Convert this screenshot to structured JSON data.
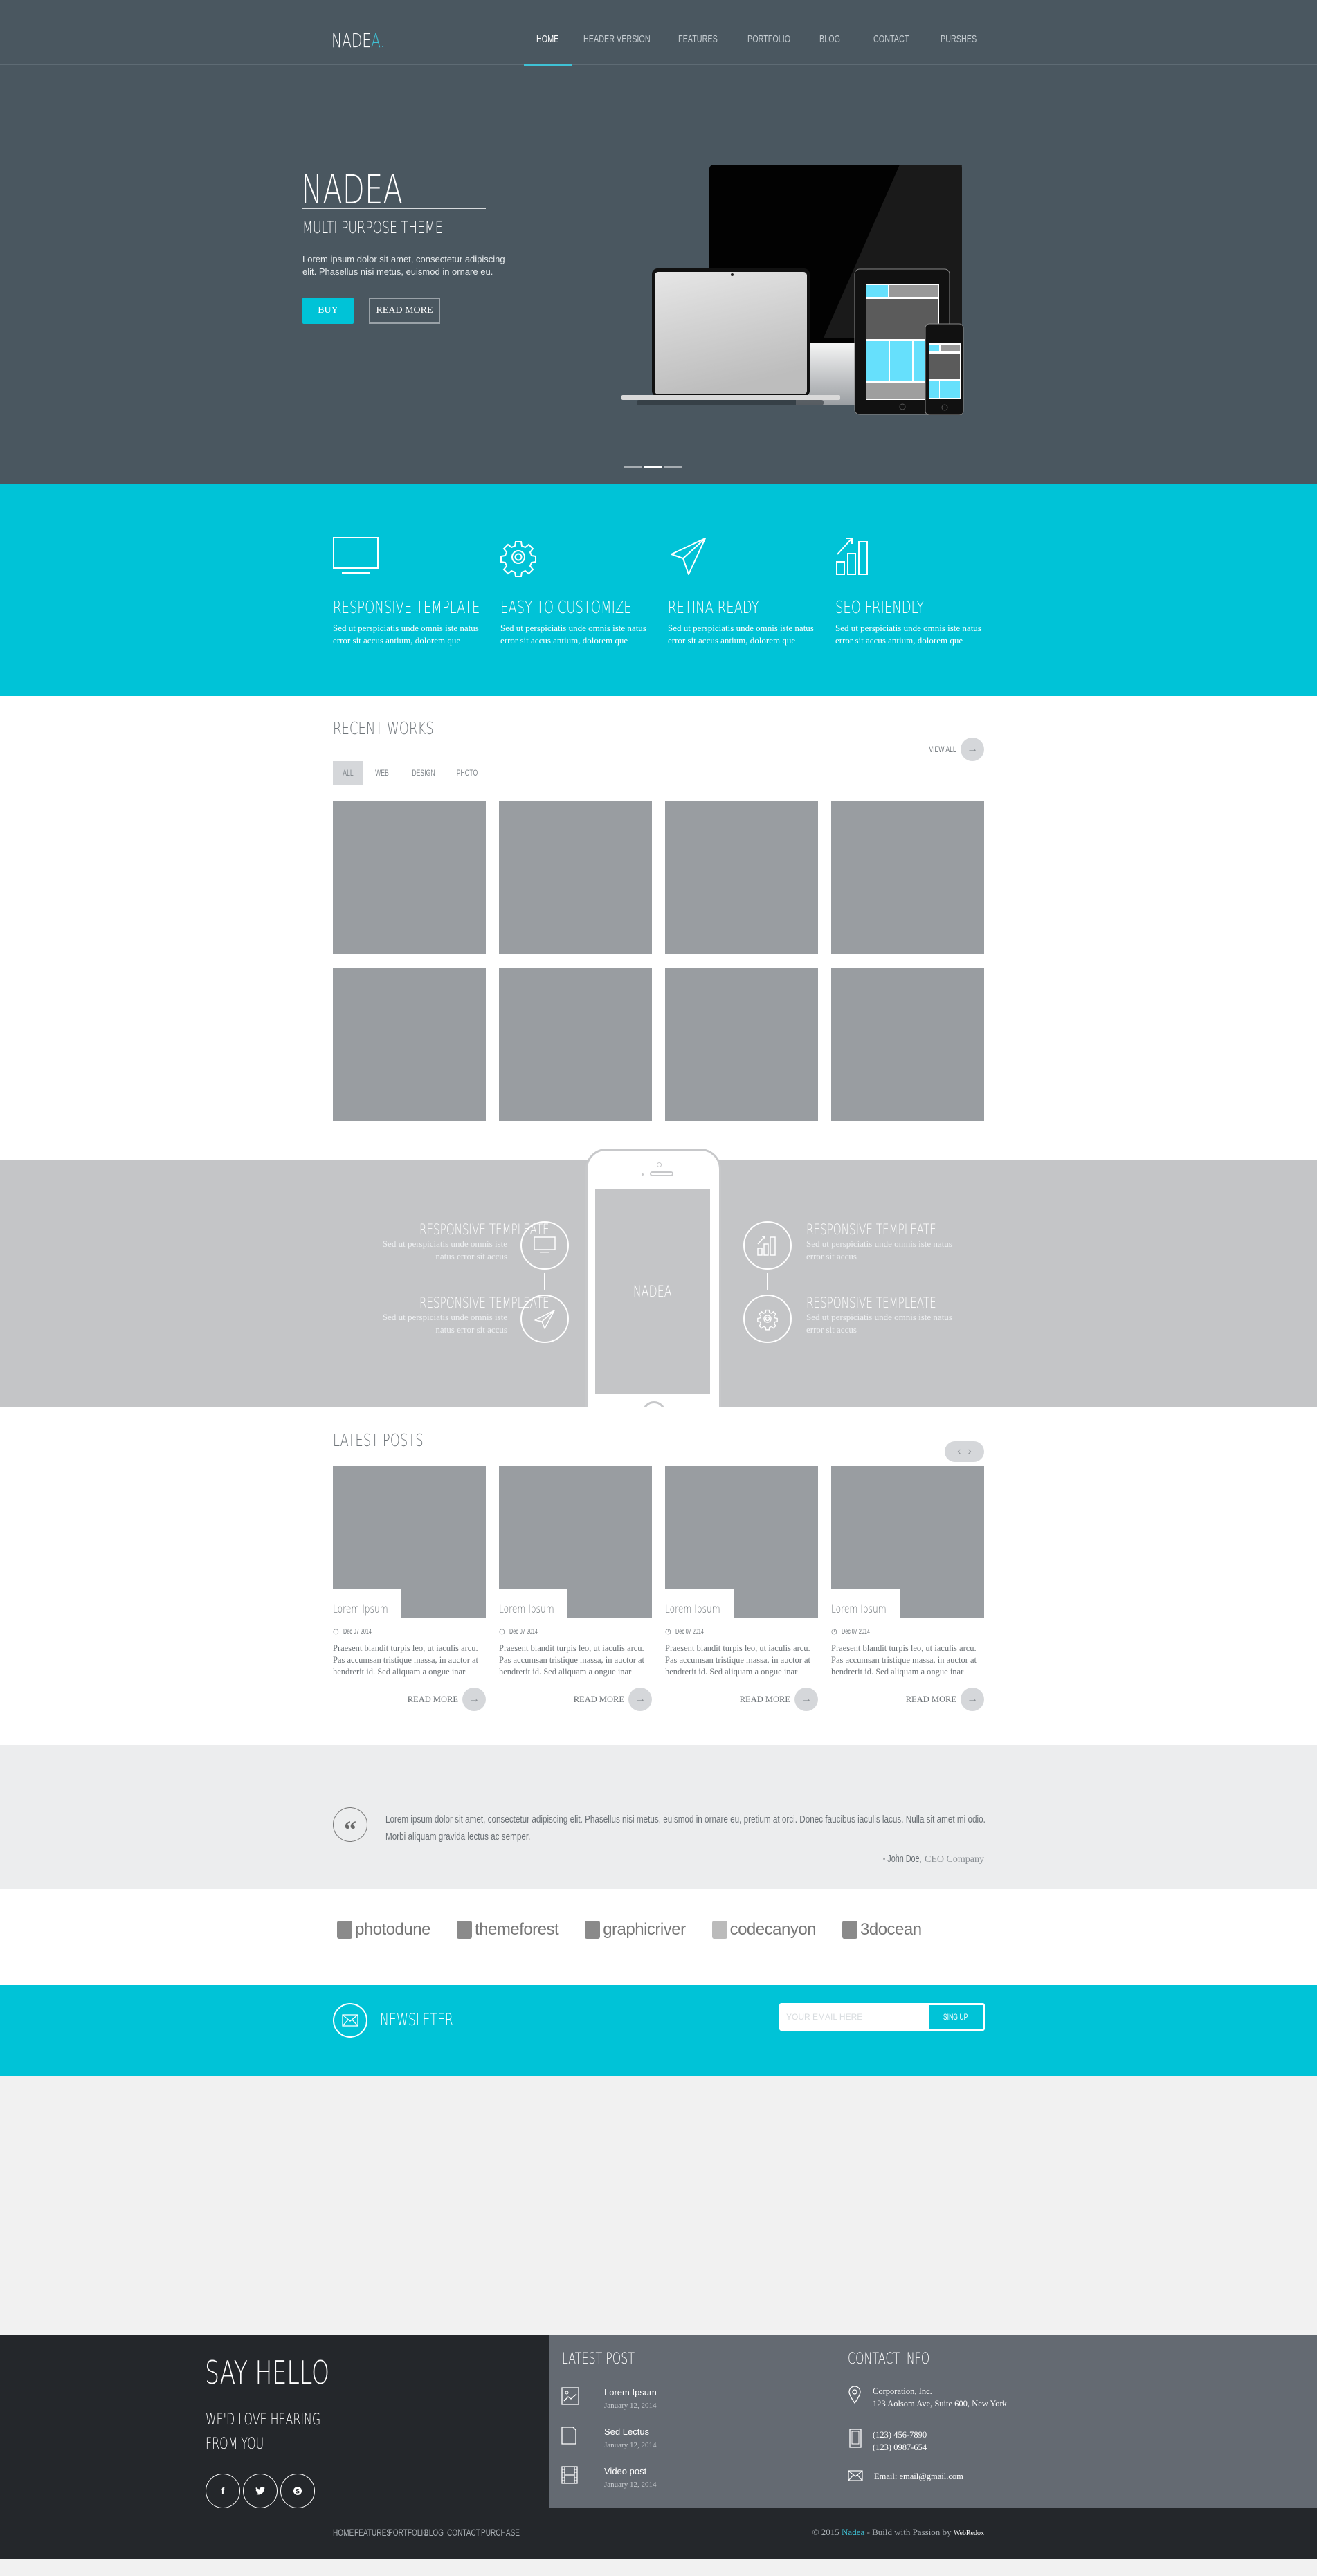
{
  "header": {
    "logo_main": "NADE",
    "logo_accent": "A.",
    "nav": [
      {
        "label": "HOME",
        "active": true
      },
      {
        "label": "HEADER VERSION",
        "active": false
      },
      {
        "label": "FEATURES",
        "active": false
      },
      {
        "label": "PORTFOLIO",
        "active": false
      },
      {
        "label": "BLOG",
        "active": false
      },
      {
        "label": "CONTACT",
        "active": false
      },
      {
        "label": "PURSHES",
        "active": false
      }
    ]
  },
  "hero": {
    "title": "NADEA",
    "subtitle": "MULTI PURPOSE THEME",
    "text": "Lorem ipsum dolor sit amet, consectetur adipiscing elit. Phasellus nisi metus, euismod in ornare eu.",
    "buy_label": "BUY",
    "read_more_label": "READ MORE",
    "slides_total": 3,
    "active_slide": 2
  },
  "features": [
    {
      "icon": "monitor-icon",
      "title": "RESPONSIVE TEMPLATE",
      "text": "Sed ut perspiciatis unde omnis iste natus error sit accus antium, dolorem que"
    },
    {
      "icon": "gear-icon",
      "title": "EASY TO CUSTOMIZE",
      "text": "Sed ut perspiciatis unde omnis iste natus error sit accus antium, dolorem que"
    },
    {
      "icon": "paper-plane-icon",
      "title": "RETINA READY",
      "text": "Sed ut perspiciatis unde omnis iste natus error sit accus antium, dolorem que"
    },
    {
      "icon": "growth-chart-icon",
      "title": "SEO FRIENDLY",
      "text": "Sed ut perspiciatis unde omnis iste natus error sit accus antium, dolorem que"
    }
  ],
  "works": {
    "title": "RECENT WORKS",
    "view_all": "VIEW ALL",
    "filters": [
      {
        "label": "ALL",
        "active": true
      },
      {
        "label": "WEB",
        "active": false
      },
      {
        "label": "DESIGN",
        "active": false
      },
      {
        "label": "PHOTO",
        "active": false
      }
    ],
    "item_count": 8
  },
  "showcase": {
    "phone_label": "NADEA",
    "left": [
      {
        "icon": "monitor-icon",
        "title": "RESPONSIVE TEMPLEATE",
        "text": "Sed ut perspiciatis unde omnis iste natus error sit accus"
      },
      {
        "icon": "paper-plane-icon",
        "title": "RESPONSIVE TEMPLEATE",
        "text": "Sed ut perspiciatis unde omnis iste natus error sit accus"
      }
    ],
    "right": [
      {
        "icon": "growth-chart-icon",
        "title": "RESPONSIVE TEMPLEATE",
        "text": "Sed ut perspiciatis unde omnis iste natus error sit accus"
      },
      {
        "icon": "gear-icon",
        "title": "RESPONSIVE TEMPLEATE",
        "text": "Sed ut perspiciatis unde omnis iste natus error sit accus"
      }
    ]
  },
  "posts": {
    "title": "LATEST POSTS",
    "items": [
      {
        "title": "Lorem Ipsum",
        "date": "Dec 07 2014",
        "text": "Praesent blandit turpis leo, ut iaculis arcu. Pas accumsan tristique massa, in auctor at hendrerit id. Sed aliquam a ongue inar",
        "more": "READ MORE"
      },
      {
        "title": "Lorem Ipsum",
        "date": "Dec 07 2014",
        "text": "Praesent blandit turpis leo, ut iaculis arcu. Pas accumsan tristique massa, in auctor at hendrerit id. Sed aliquam a ongue inar",
        "more": "READ MORE"
      },
      {
        "title": "Lorem Ipsum",
        "date": "Dec 07 2014",
        "text": "Praesent blandit turpis leo, ut iaculis arcu. Pas accumsan tristique massa, in auctor at hendrerit id. Sed aliquam a ongue inar",
        "more": "READ MORE"
      },
      {
        "title": "Lorem Ipsum",
        "date": "Dec 07 2014",
        "text": "Praesent blandit turpis leo, ut iaculis arcu. Pas accumsan tristique massa, in auctor at hendrerit id. Sed aliquam a ongue inar",
        "more": "READ MORE"
      }
    ]
  },
  "testimonial": {
    "quote": "Lorem ipsum dolor sit amet, consectetur adipiscing elit. Phasellus nisi metus, euismod in ornare eu, pretium at orci. Donec faucibus iaculis lacus. Nulla sit amet mi odio. Morbi aliquam gravida lectus ac semper.",
    "author": "- John Doe,",
    "role": "CEO Company"
  },
  "clients": [
    "photodune",
    "themeforest",
    "graphicriver",
    "codecanyon",
    "3docean"
  ],
  "newsletter": {
    "title": "NEWSLETER",
    "placeholder": "YOUR EMAIL HERE",
    "button": "SING UP"
  },
  "footer": {
    "say_hello": "SAY HELLO",
    "love_line1": "WE'D LOVE HEARING",
    "love_line2": "FROM YOU",
    "socials": [
      {
        "icon": "facebook-icon",
        "glyph": "f"
      },
      {
        "icon": "twitter-icon",
        "glyph": "t"
      },
      {
        "icon": "skype-icon",
        "glyph": "S"
      }
    ],
    "latest_post_title": "LATEST POST",
    "latest_posts": [
      {
        "icon": "image-icon",
        "title": "Lorem Ipsum",
        "date": "January 12, 2014"
      },
      {
        "icon": "document-icon",
        "title": "Sed Lectus",
        "date": "January 12, 2014"
      },
      {
        "icon": "film-icon",
        "title": "Video post",
        "date": "January 12, 2014"
      }
    ],
    "contact_title": "CONTACT INFO",
    "contact": {
      "company": "Corporation, Inc.",
      "address": "123 Aolsom Ave, Suite 600, New York",
      "phone1": "(123) 456-7890",
      "phone2": "(123) 0987-654",
      "email": "Email: email@gmail.com"
    },
    "bottom_nav": [
      "HOME",
      "FEATURES",
      "PORTFOLIO",
      "BLOG",
      "CONTACT",
      "PURCHASE"
    ],
    "copyright_pre": "© 2015 ",
    "copyright_brand": "Nadea",
    "copyright_mid": " - Build with Passion by ",
    "copyright_web": "WebRedox"
  },
  "colors": {
    "accent": "#00c3d7",
    "hero_bg": "#4a5760",
    "placeholder_gray": "#999da1",
    "showcase_bg": "#c4c5c7",
    "footer_dark": "#24272b",
    "footer_mid": "#646a72"
  }
}
